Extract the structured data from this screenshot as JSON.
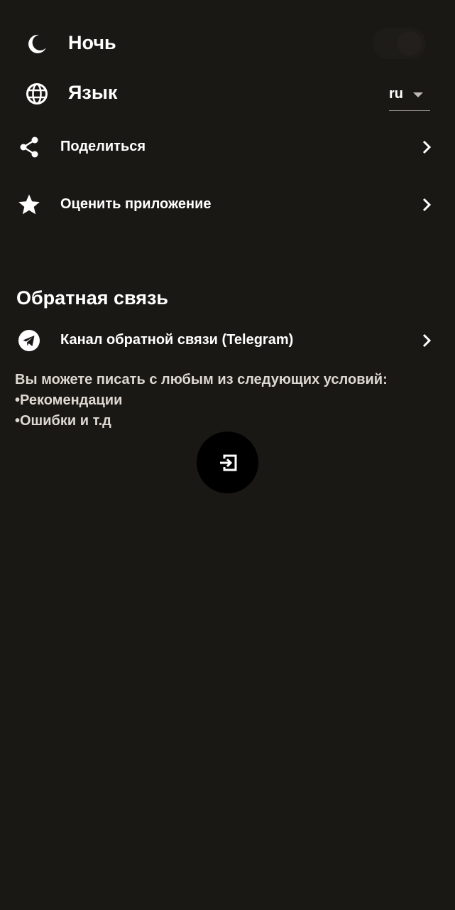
{
  "settings": {
    "night": {
      "label": "Ночь",
      "icon": "moon-icon",
      "enabled": false
    },
    "language": {
      "label": "Язык",
      "icon": "globe-icon",
      "value": "ru"
    },
    "share": {
      "label": "Поделиться",
      "icon": "share-icon"
    },
    "rate": {
      "label": "Оценить приложение",
      "icon": "star-icon"
    }
  },
  "feedback": {
    "title": "Обратная связь",
    "channel": {
      "label": "Канал обратной связи (Telegram)",
      "icon": "telegram-icon"
    },
    "note": {
      "line1": "Вы можете писать с любым из следующих условий:",
      "line2": "•Рекомендации",
      "line3": "•Ошибки и т.д"
    }
  },
  "fab": {
    "icon": "logout-icon"
  },
  "colors": {
    "background": "#1a1814",
    "text": "#ffffff",
    "note_text": "#dfd8d2",
    "fab": "#000000"
  }
}
